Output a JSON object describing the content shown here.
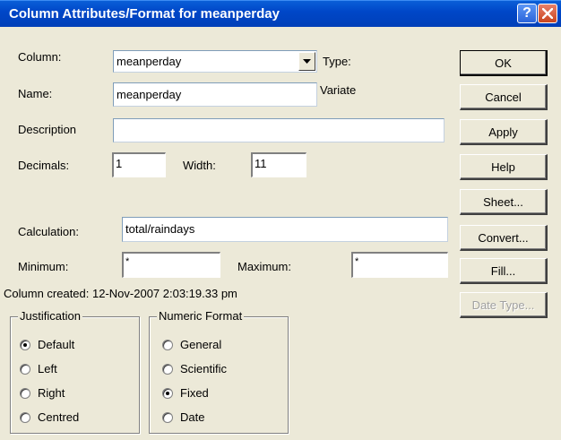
{
  "window": {
    "title": "Column Attributes/Format for meanperday",
    "help_glyph": "?",
    "close_icon": "close-icon",
    "help_icon": "help-icon"
  },
  "form": {
    "column_label": "Column:",
    "column_value": "meanperday",
    "type_label": "Type:",
    "type_value": "Variate",
    "name_label": "Name:",
    "name_value": "meanperday",
    "description_label": "Description",
    "description_value": "",
    "decimals_label": "Decimals:",
    "decimals_value": "1",
    "width_label": "Width:",
    "width_value": "11",
    "calculation_label": "Calculation:",
    "calculation_value": "total/raindays",
    "minimum_label": "Minimum:",
    "minimum_value": "*",
    "maximum_label": "Maximum:",
    "maximum_value": "*",
    "created_text": "Column created: 12-Nov-2007 2:03:19.33 pm"
  },
  "buttons": {
    "ok": "OK",
    "cancel": "Cancel",
    "apply": "Apply",
    "help": "Help",
    "sheet": "Sheet...",
    "convert": "Convert...",
    "fill": "Fill...",
    "date_type": "Date Type..."
  },
  "justification": {
    "label": "Justification",
    "options": [
      "Default",
      "Left",
      "Right",
      "Centred"
    ],
    "selected": "Default"
  },
  "numeric_format": {
    "label": "Numeric Format",
    "options": [
      "General",
      "Scientific",
      "Fixed",
      "Date"
    ],
    "selected": "Fixed"
  },
  "colors": {
    "titlebar": "#0047C8",
    "dialog_bg": "#ECE9D8",
    "close_button": "#C9451E"
  }
}
